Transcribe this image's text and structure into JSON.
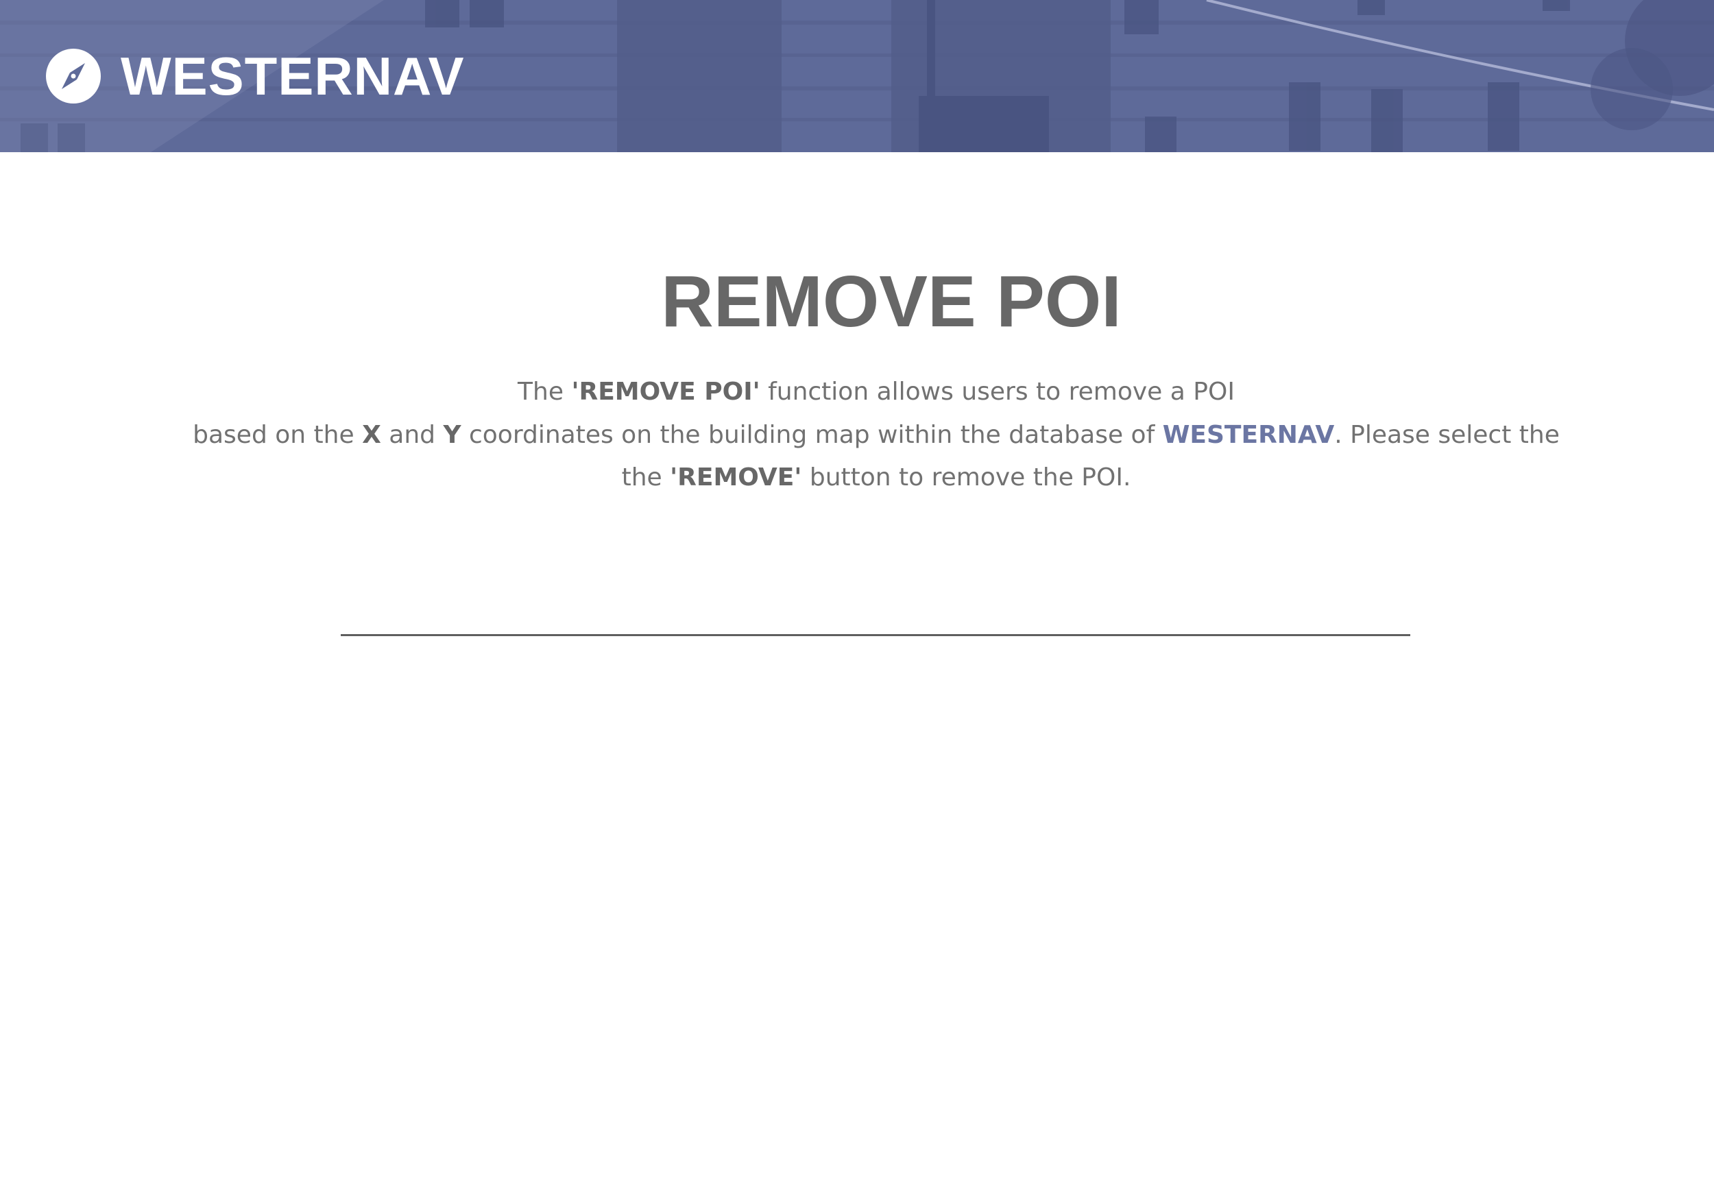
{
  "header": {
    "brand_name": "WESTERNAV",
    "logo_icon": "compass-icon",
    "banner_color": "#5e6a99"
  },
  "main": {
    "title": "REMOVE POI",
    "description": {
      "line1": {
        "pre": "The ",
        "bold": "'REMOVE POI'",
        "post": " function allows users to remove a POI"
      },
      "line2": {
        "pre": "based on the ",
        "x": "X",
        "mid": " and ",
        "y": "Y",
        "post": " coordinates on the building map within the database of ",
        "brand": "WESTERNAV",
        "tail": ". Please select the"
      },
      "line3": {
        "pre": "the ",
        "bold": "'REMOVE'",
        "post": " button to remove the POI."
      }
    }
  },
  "colors": {
    "text": "#717171",
    "title": "#676767",
    "accent": "#6b76a3"
  }
}
